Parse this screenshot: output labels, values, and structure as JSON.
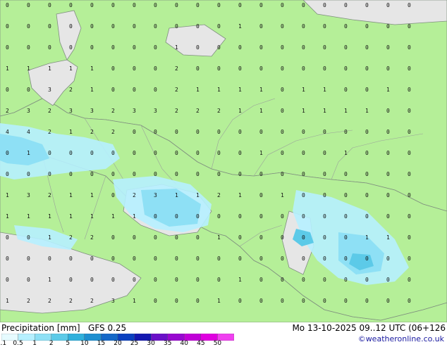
{
  "map": {
    "colors": {
      "land": "#b5ef98",
      "sea": "#e6e6e6",
      "border": "#9aa29a",
      "coast": "#7f8f7f"
    },
    "grid_values": [
      "0",
      "0",
      "0",
      "0",
      "0",
      "0",
      "0",
      "0",
      "0",
      "0",
      "0",
      "0",
      "0",
      "0",
      "0",
      "0",
      "0",
      "0",
      "0",
      "0",
      "0",
      "0",
      "0",
      "0",
      "0",
      "0",
      "0",
      "0",
      "0",
      "0",
      "0",
      "1",
      "0",
      "0",
      "0",
      "0",
      "0",
      "0",
      "0",
      "0",
      "0",
      "0",
      "0",
      "0",
      "0",
      "0",
      "0",
      "0",
      "1",
      "0",
      "0",
      "0",
      "0",
      "0",
      "0",
      "0",
      "0",
      "0",
      "0",
      "0",
      "1",
      "1",
      "1",
      "1",
      "1",
      "0",
      "0",
      "0",
      "2",
      "0",
      "0",
      "0",
      "0",
      "0",
      "0",
      "0",
      "0",
      "0",
      "0",
      "0",
      "0",
      "0",
      "3",
      "2",
      "1",
      "0",
      "0",
      "0",
      "2",
      "1",
      "1",
      "1",
      "1",
      "0",
      "1",
      "1",
      "0",
      "0",
      "1",
      "0",
      "2",
      "3",
      "2",
      "3",
      "3",
      "2",
      "3",
      "3",
      "2",
      "2",
      "2",
      "1",
      "1",
      "0",
      "1",
      "1",
      "1",
      "1",
      "0",
      "0",
      "4",
      "4",
      "2",
      "1",
      "2",
      "2",
      "0",
      "0",
      "0",
      "0",
      "0",
      "0",
      "0",
      "0",
      "0",
      "0",
      "0",
      "0",
      "0",
      "0",
      "0",
      "1",
      "0",
      "0",
      "0",
      "0",
      "0",
      "0",
      "0",
      "0",
      "0",
      "0",
      "1",
      "0",
      "0",
      "0",
      "1",
      "0",
      "0",
      "0",
      "0",
      "0",
      "0",
      "0",
      "0",
      "0",
      "0",
      "0",
      "0",
      "0",
      "0",
      "0",
      "0",
      "0",
      "0",
      "0",
      "0",
      "0",
      "0",
      "0",
      "1",
      "3",
      "2",
      "1",
      "1",
      "0",
      "2",
      "3",
      "1",
      "1",
      "2",
      "1",
      "0",
      "1",
      "0",
      "0",
      "0",
      "0",
      "0",
      "0",
      "1",
      "1",
      "1",
      "1",
      "1",
      "1",
      "1",
      "0",
      "0",
      "0",
      "0",
      "0",
      "0",
      "0",
      "0",
      "0",
      "0",
      "0",
      "0",
      "0",
      "0",
      "0",
      "1",
      "2",
      "2",
      "0",
      "0",
      "0",
      "0",
      "0",
      "1",
      "0",
      "0",
      "0",
      "0",
      "0",
      "0",
      "1",
      "1",
      "0",
      "0",
      "0",
      "0",
      "0",
      "0",
      "0",
      "0",
      "0",
      "0",
      "0",
      "0",
      "0",
      "0",
      "0",
      "0",
      "0",
      "0",
      "0",
      "0",
      "0",
      "0",
      "0",
      "1",
      "0",
      "0",
      "0",
      "0",
      "0",
      "0",
      "0",
      "0",
      "1",
      "0",
      "0",
      "0",
      "0",
      "0",
      "0",
      "0",
      "0",
      "1",
      "2",
      "2",
      "2",
      "2",
      "3",
      "1",
      "0",
      "0",
      "0",
      "1",
      "0",
      "0",
      "0",
      "0",
      "0",
      "0",
      "0",
      "0",
      "0"
    ]
  },
  "legend": {
    "title": "Precipitation [mm]",
    "model": "GFS 0.25",
    "run_info": "Mo 13-10-2025 09..12 UTC (06+126",
    "credit": "©weatheronline.co.uk",
    "scale_values": [
      "0.1",
      "0.5",
      "1",
      "2",
      "5",
      "10",
      "15",
      "20",
      "25",
      "30",
      "35",
      "40",
      "45",
      "50"
    ],
    "scale_colors": [
      "#e6fbff",
      "#b6f0ff",
      "#8ee0f5",
      "#5ccae8",
      "#2fb0dc",
      "#1d8fd0",
      "#1468c8",
      "#0a40c0",
      "#1418b0",
      "#6a10c8",
      "#9808d0",
      "#c000d8",
      "#e000e0",
      "#f040f0"
    ]
  }
}
